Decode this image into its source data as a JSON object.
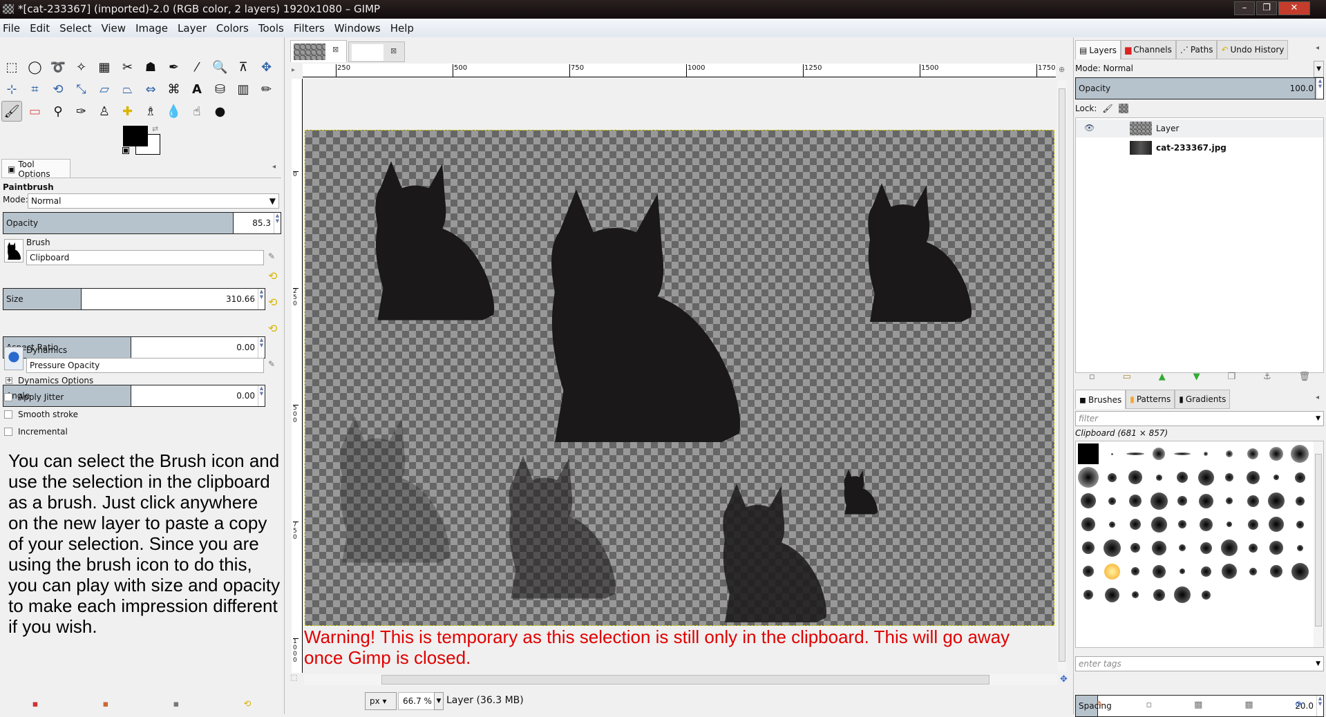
{
  "window": {
    "title": "*[cat-233367] (imported)-2.0 (RGB color, 2 layers) 1920x1080 – GIMP",
    "minimize": "–",
    "maximize": "❐",
    "close": "✕"
  },
  "menu": [
    "File",
    "Edit",
    "Select",
    "View",
    "Image",
    "Layer",
    "Colors",
    "Tools",
    "Filters",
    "Windows",
    "Help"
  ],
  "toolbox": {
    "tools": [
      "rect-select",
      "ellipse-select",
      "free-select",
      "fuzzy-select",
      "select-by-color",
      "scissors",
      "foreground-select",
      "paths",
      "color-picker",
      "zoom",
      "measure",
      "move",
      "align",
      "crop",
      "rotate",
      "scale",
      "shear",
      "perspective",
      "flip",
      "cage-transform",
      "text",
      "bucket-fill",
      "blend",
      "pencil",
      "paintbrush",
      "eraser",
      "airbrush",
      "ink",
      "clone",
      "heal",
      "perspective-clone",
      "blur-sharpen",
      "smudge",
      "dodge-burn"
    ],
    "active_tool": "paintbrush",
    "foreground_color": "#000000",
    "background_color": "#ffffff"
  },
  "tool_options": {
    "tab": "Tool Options",
    "tool_name": "Paintbrush",
    "mode_label": "Mode:",
    "mode": "Normal",
    "opacity_label": "Opacity",
    "opacity": "85.3",
    "brush_label": "Brush",
    "brush": "Clipboard",
    "size_label": "Size",
    "size": "310.66",
    "aspect_label": "Aspect Ratio",
    "aspect": "0.00",
    "angle_label": "Angle",
    "angle": "0.00",
    "dynamics_label": "Dynamics",
    "dynamics": "Pressure Opacity",
    "dynamics_options": "Dynamics Options",
    "apply_jitter": "Apply Jitter",
    "smooth_stroke": "Smooth stroke",
    "incremental": "Incremental"
  },
  "instructions": "You can select the Brush icon and use the selection in the clipboard as a brush.  Just click anywhere on the new layer to paste a copy of your selection.  Since you are using the brush icon to do this, you can play with size and opacity to make each impression different if you wish.",
  "canvas": {
    "ruler_top": [
      "250",
      "500",
      "750",
      "1000",
      "1250",
      "1500",
      "1750"
    ],
    "ruler_left": [
      "0",
      "250",
      "500",
      "750",
      "1000"
    ],
    "warning": "Warning! This is temporary as this selection is still only in the clipboard. This will go away once Gimp is closed.",
    "warning_color": "#e00000"
  },
  "status": {
    "unit": "px",
    "zoom": "66.7 %",
    "info": "Layer (36.3 MB)"
  },
  "layers_panel": {
    "tabs": [
      "Layers",
      "Channels",
      "Paths",
      "Undo History"
    ],
    "mode": "Mode: Normal",
    "opacity_label": "Opacity",
    "opacity": "100.0",
    "lock_label": "Lock:",
    "layers": [
      {
        "name": "Layer",
        "visible": true
      },
      {
        "name": "cat-233367.jpg",
        "visible": false
      }
    ]
  },
  "brushes_panel": {
    "tabs": [
      "Brushes",
      "Patterns",
      "Gradients"
    ],
    "filter_placeholder": "filter",
    "selected_brush": "Clipboard (681 × 857)",
    "tags_placeholder": "enter tags",
    "spacing_label": "Spacing",
    "spacing": "20.0"
  }
}
